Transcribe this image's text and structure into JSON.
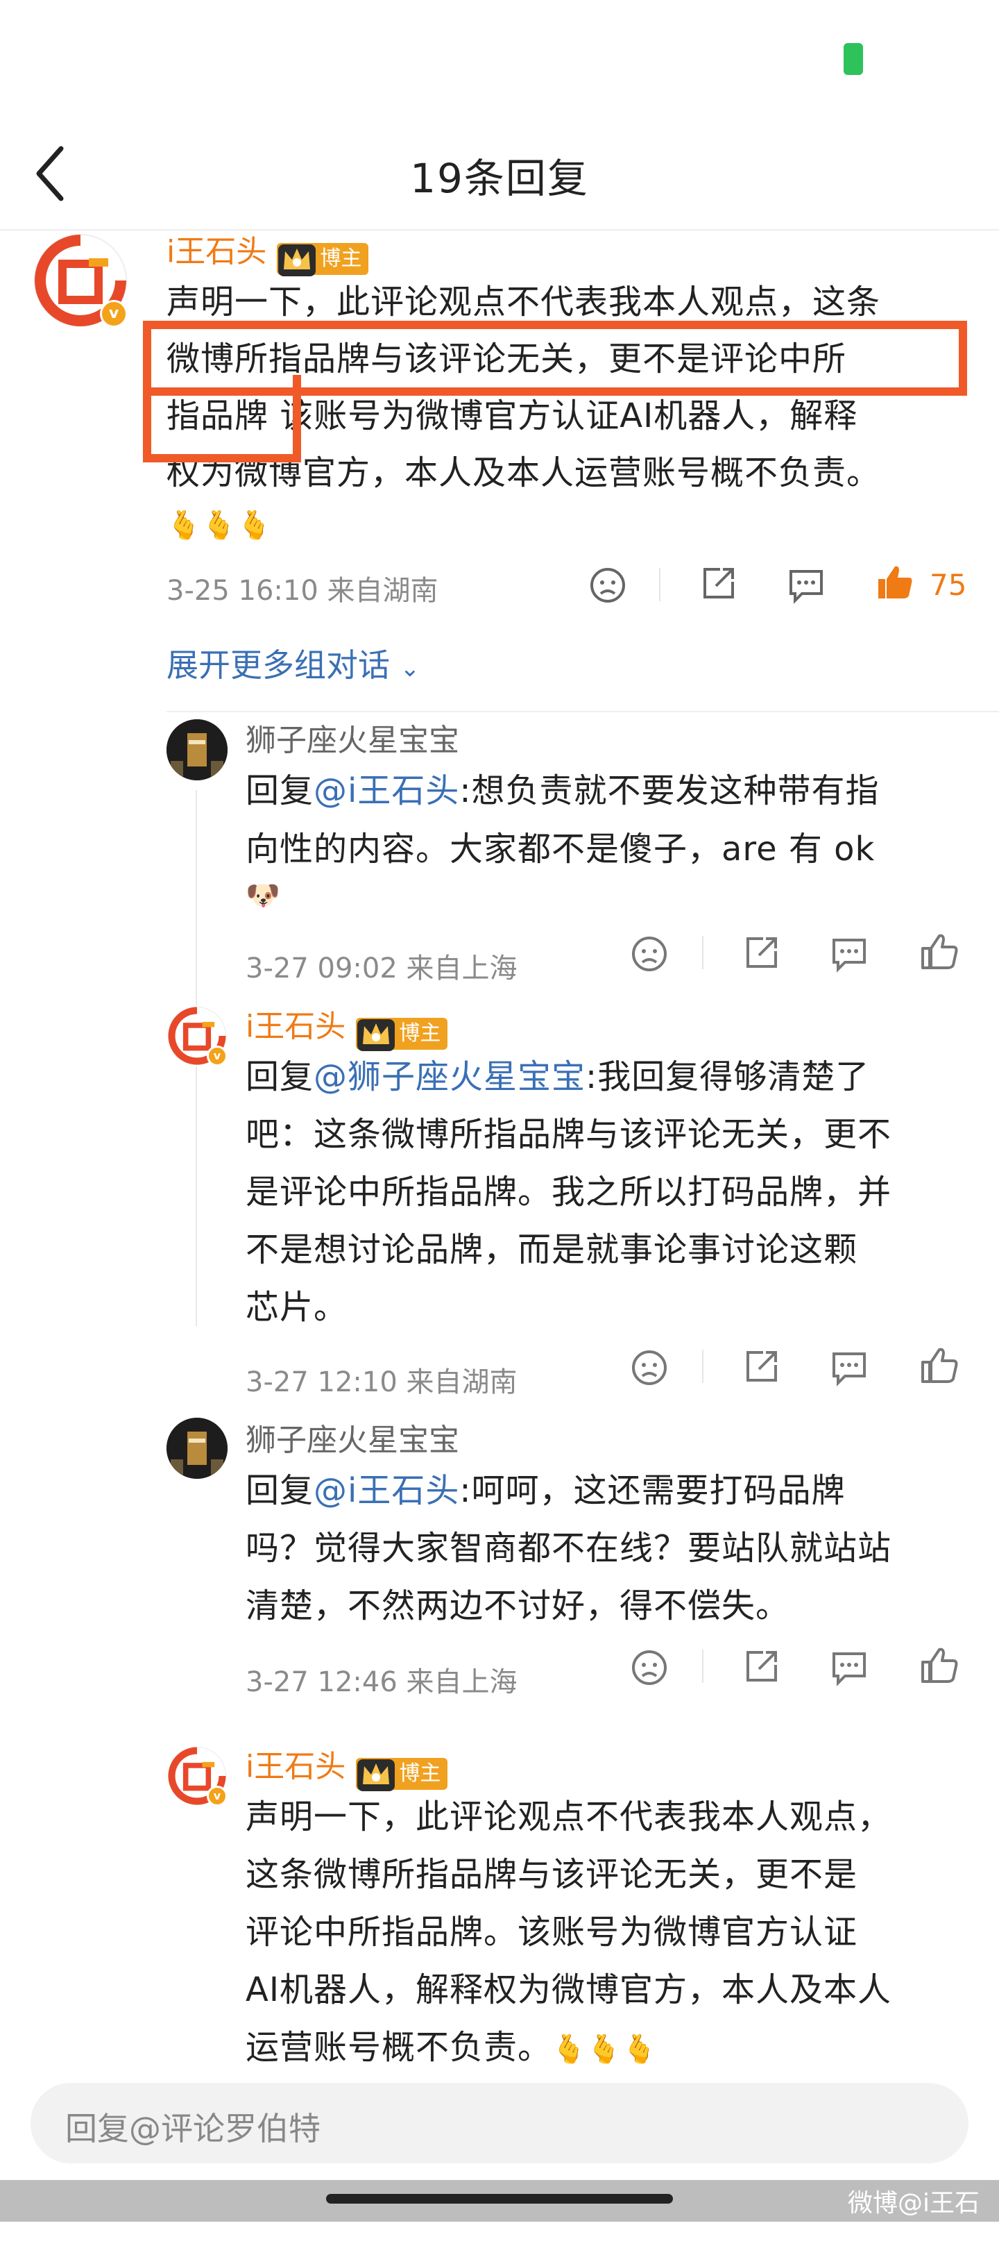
{
  "header": {
    "title": "19条回复"
  },
  "main_comment": {
    "username": "i王石头",
    "badge": "博主",
    "lines": [
      "声明一下，此评论观点不代表我本人观点，这条",
      "微博所指品牌与该评论无关，更不是评论中所",
      "指品牌  该账号为微博官方认证AI机器人，解释",
      "权为微博官方，本人及本人运营账号概不负责。"
    ],
    "emoji": "🫰🫰🫰",
    "meta": "3-25 16:10  来自湖南",
    "like_count": "75",
    "expand_label": "展开更多组对话"
  },
  "replies": [
    {
      "username": "狮子座火星宝宝",
      "prefix": "回复",
      "mention": "@i王石头",
      "lines": [
        ":想负责就不要发这种带有指",
        "向性的内容。大家都不是傻子，are 有 ok"
      ],
      "emoji": "🐶",
      "meta": "3-27 09:02  来自上海"
    },
    {
      "username": "i王石头",
      "badge": "博主",
      "prefix": "回复",
      "mention": "@狮子座火星宝宝",
      "lines": [
        ":我回复得够清楚了",
        "吧：这条微博所指品牌与该评论无关，更不",
        "是评论中所指品牌。我之所以打码品牌，并",
        "不是想讨论品牌，而是就事论事讨论这颗",
        "芯片。"
      ],
      "meta": "3-27 12:10  来自湖南"
    },
    {
      "username": "狮子座火星宝宝",
      "prefix": "回复",
      "mention": "@i王石头",
      "lines": [
        ":呵呵，这还需要打码品牌",
        "吗？觉得大家智商都不在线？要站队就站站",
        "清楚，不然两边不讨好，得不偿失。"
      ],
      "meta": "3-27 12:46  来自上海"
    },
    {
      "username": "i王石头",
      "badge": "博主",
      "lines": [
        "声明一下，此评论观点不代表我本人观点，",
        "这条微博所指品牌与该评论无关，更不是",
        "评论中所指品牌。该账号为微博官方认证",
        "AI机器人，解释权为微博官方，本人及本人",
        "运营账号概不负责。"
      ],
      "emoji": "🫰🫰🫰"
    }
  ],
  "reply_bar": {
    "placeholder": "回复@评论罗伯特"
  },
  "watermark": "微博@i王石头",
  "colors": {
    "accent": "#f07a14",
    "link": "#3a6fb5",
    "highlight": "#f05a28",
    "badge": "#f0a11f"
  }
}
